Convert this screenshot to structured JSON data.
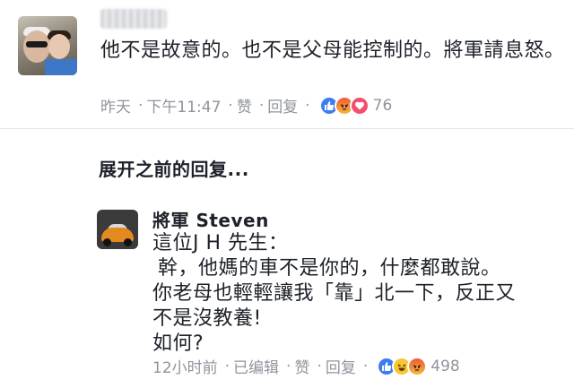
{
  "comment1": {
    "text": "他不是故意的。也不是父母能控制的。將軍請息怒。",
    "meta": {
      "time": "昨天",
      "clock": "下午11:47",
      "like": "赞",
      "reply": "回复",
      "count": "76",
      "reactions": [
        "like",
        "angry",
        "love"
      ]
    }
  },
  "expand_replies": "展开之前的回复...",
  "comment2": {
    "name": "將軍 Steven",
    "lines": [
      "這位J H 先生：",
      "幹，他媽的車不是你的，什麼都敢說。",
      "你老母也輕輕讓我「靠」北一下，反正又",
      "不是沒教養!",
      "如何?"
    ],
    "meta": {
      "time": "12小时前",
      "edited": "已编辑",
      "like": "赞",
      "reply": "回复",
      "count": "498",
      "reactions": [
        "like",
        "haha",
        "angry"
      ]
    }
  },
  "colors": {
    "like": "#3b7df0",
    "love": "#f0506e",
    "haha": "#f7c631",
    "angry": "#f05a3a",
    "meta_text": "#90949c"
  }
}
